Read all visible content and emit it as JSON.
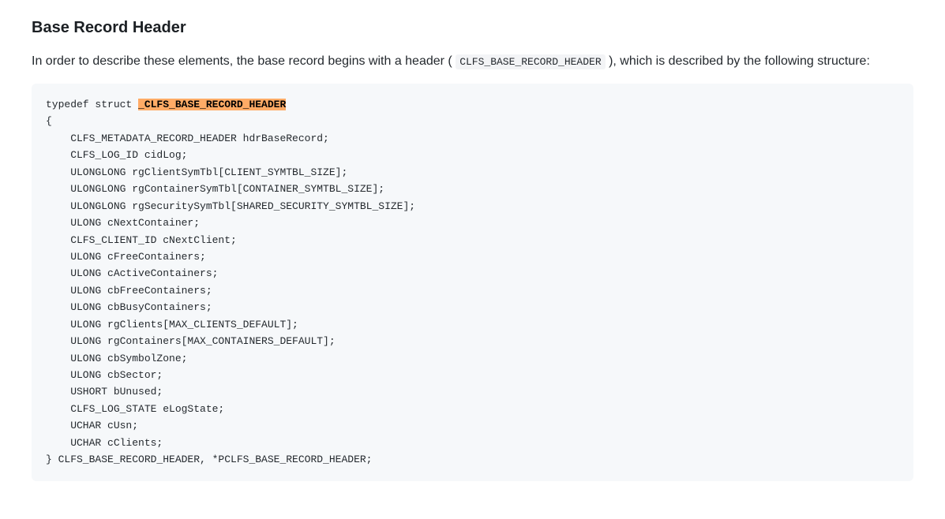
{
  "heading": "Base Record Header",
  "intro": {
    "before": "In order to describe these elements, the base record begins with a header ( ",
    "inline_code": "CLFS_BASE_RECORD_HEADER",
    "after": " ), which is described by the following structure:"
  },
  "code": {
    "typedef": "typedef struct ",
    "highlighted": "_CLFS_BASE_RECORD_HEADER",
    "open_brace": "{",
    "members": [
      "CLFS_METADATA_RECORD_HEADER hdrBaseRecord;",
      "CLFS_LOG_ID cidLog;",
      "ULONGLONG rgClientSymTbl[CLIENT_SYMTBL_SIZE];",
      "ULONGLONG rgContainerSymTbl[CONTAINER_SYMTBL_SIZE];",
      "ULONGLONG rgSecuritySymTbl[SHARED_SECURITY_SYMTBL_SIZE];",
      "ULONG cNextContainer;",
      "CLFS_CLIENT_ID cNextClient;",
      "ULONG cFreeContainers;",
      "ULONG cActiveContainers;",
      "ULONG cbFreeContainers;",
      "ULONG cbBusyContainers;",
      "ULONG rgClients[MAX_CLIENTS_DEFAULT];",
      "ULONG rgContainers[MAX_CONTAINERS_DEFAULT];",
      "ULONG cbSymbolZone;",
      "ULONG cbSector;",
      "USHORT bUnused;",
      "CLFS_LOG_STATE eLogState;",
      "UCHAR cUsn;",
      "UCHAR cClients;"
    ],
    "close_line": "} CLFS_BASE_RECORD_HEADER, *PCLFS_BASE_RECORD_HEADER;"
  }
}
